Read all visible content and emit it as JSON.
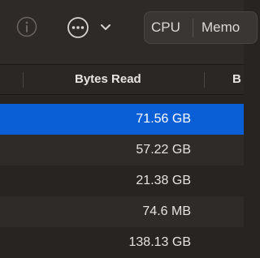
{
  "toolbar": {
    "segments": [
      "CPU",
      "Memo"
    ]
  },
  "table": {
    "columns": [
      {
        "title": ""
      },
      {
        "title": "Bytes Read"
      },
      {
        "title": "B"
      }
    ],
    "rows": [
      {
        "bytes_read": "71.56 GB",
        "selected": true
      },
      {
        "bytes_read": "57.22 GB",
        "selected": false
      },
      {
        "bytes_read": "21.38 GB",
        "selected": false
      },
      {
        "bytes_read": "74.6 MB",
        "selected": false
      },
      {
        "bytes_read": "138.13 GB",
        "selected": false
      }
    ]
  },
  "colors": {
    "selection": "#0a5fd6",
    "background": "#282422"
  },
  "icons": [
    "info-icon",
    "ellipsis-circle-icon",
    "chevron-down-icon"
  ]
}
